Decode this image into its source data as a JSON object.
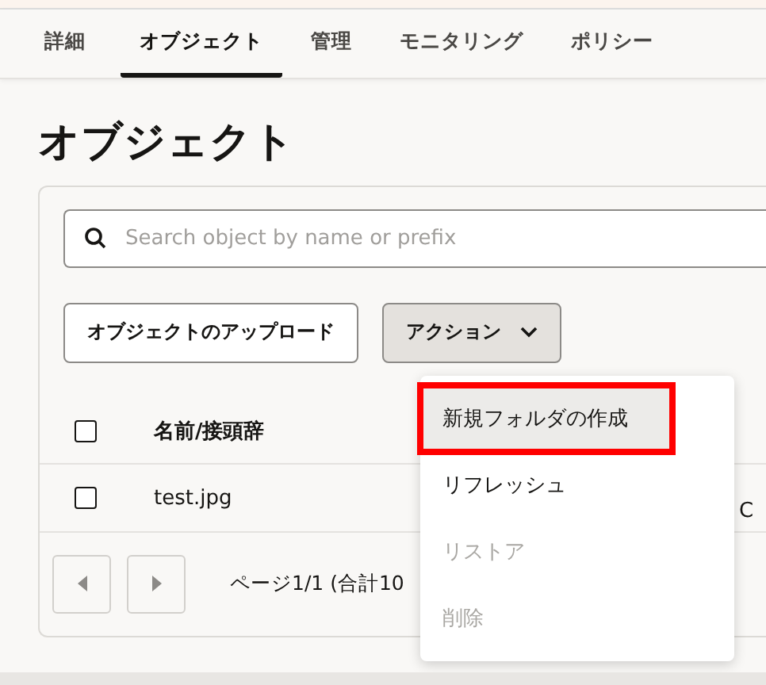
{
  "tabs": [
    {
      "label": "詳細",
      "selected": false
    },
    {
      "label": "オブジェクト",
      "selected": true
    },
    {
      "label": "管理",
      "selected": false
    },
    {
      "label": "モニタリング",
      "selected": false
    },
    {
      "label": "ポリシー",
      "selected": false
    }
  ],
  "page_title": "オブジェクト",
  "search": {
    "placeholder": "Search object by name or prefix"
  },
  "buttons": [
    {
      "label": "オブジェクトのアップロード",
      "kind": "plain"
    },
    {
      "label": "アクション",
      "kind": "dropdown"
    }
  ],
  "table": {
    "header": {
      "checked": false,
      "label": "名前/接頭辞"
    },
    "rows": [
      {
        "checked": false,
        "name": "test.jpg",
        "column_3": "C"
      }
    ]
  },
  "pager": {
    "text": "ページ1/1 (合計10"
  },
  "menu": [
    {
      "label": "新規フォルダの作成",
      "disabled": false,
      "hovered": true,
      "highlighted": true
    },
    {
      "label": "リフレッシュ",
      "disabled": false,
      "hovered": false,
      "highlighted": false
    },
    {
      "label": "リストア",
      "disabled": true,
      "hovered": false,
      "highlighted": false
    },
    {
      "label": "削除",
      "disabled": true,
      "hovered": false,
      "highlighted": false
    }
  ]
}
